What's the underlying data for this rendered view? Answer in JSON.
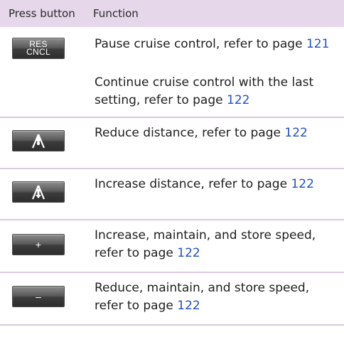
{
  "header": {
    "col_button": "Press button",
    "col_function": "Function"
  },
  "colors": {
    "header_bg": "#e6d7ea",
    "link": "#1f4fc7",
    "divider": "#d8c9dc"
  },
  "rows": [
    {
      "button": {
        "icon": "res-cncl-button",
        "label": "RES\nCNCL"
      },
      "entries": [
        {
          "text": "Pause cruise control, refer to page ",
          "link": "121"
        },
        {
          "text": "Continue cruise control with the last setting, refer to page ",
          "link": "122"
        }
      ]
    },
    {
      "button": {
        "icon": "reduce-distance-icon"
      },
      "entries": [
        {
          "text": "Reduce distance, refer to page ",
          "link": "122"
        }
      ]
    },
    {
      "button": {
        "icon": "increase-distance-icon"
      },
      "entries": [
        {
          "text": "Increase distance, refer to page ",
          "link": "122"
        }
      ]
    },
    {
      "button": {
        "icon": "plus-icon",
        "label": "+"
      },
      "entries": [
        {
          "text": "Increase, maintain, and store speed, refer to page ",
          "link": "122"
        }
      ]
    },
    {
      "button": {
        "icon": "minus-icon",
        "label": "–"
      },
      "entries": [
        {
          "text": "Reduce, maintain, and store speed, refer to page ",
          "link": "122"
        }
      ]
    }
  ]
}
